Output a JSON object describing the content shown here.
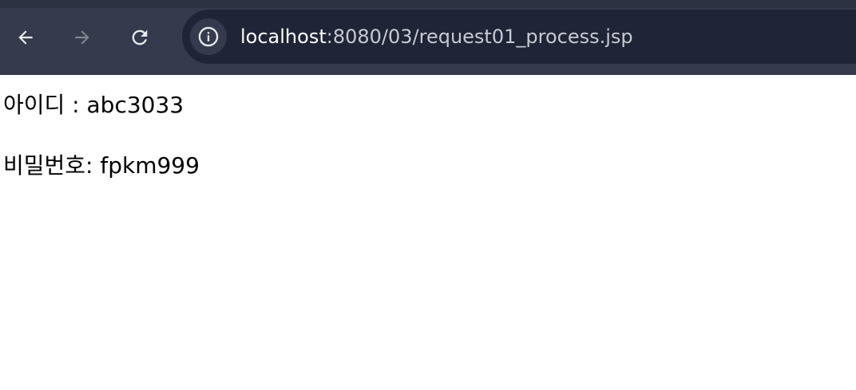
{
  "browser": {
    "back_icon": "arrow-left-icon",
    "forward_icon": "arrow-right-icon",
    "reload_icon": "reload-icon",
    "site_info_icon": "info-icon",
    "url_host": "localhost",
    "url_path": ":8080/03/request01_process.jsp"
  },
  "page": {
    "id_line": "아이디 : abc3033",
    "password_line": "비밀번호: fpkm999"
  }
}
